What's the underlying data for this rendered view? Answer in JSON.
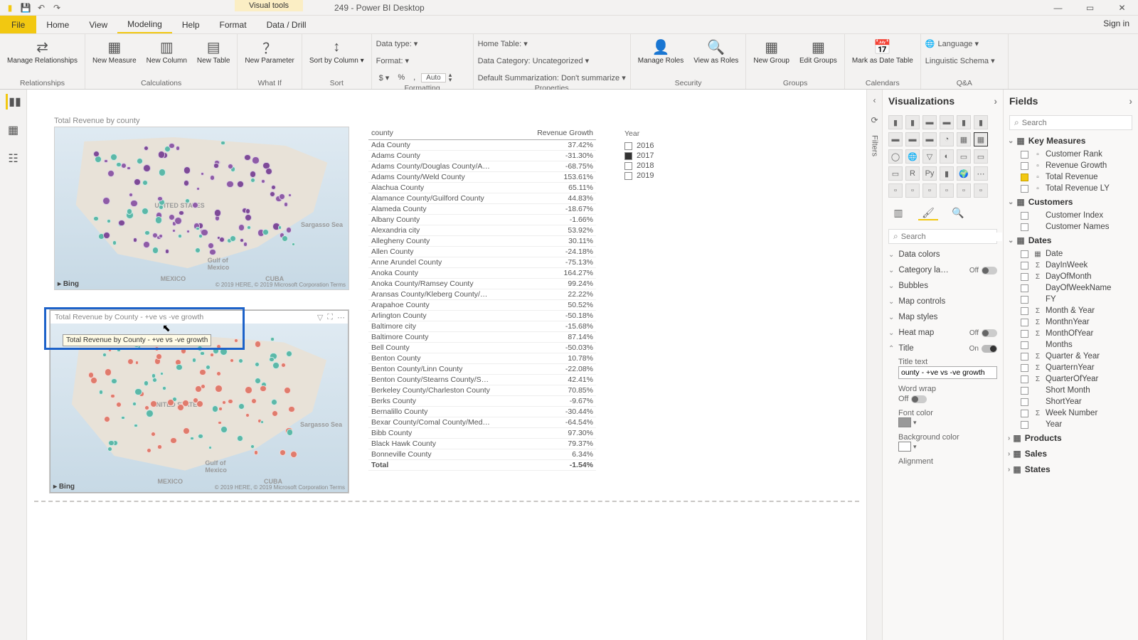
{
  "title": "249 - Power BI Desktop",
  "visualtools": "Visual tools",
  "menutabs": {
    "file": "File",
    "home": "Home",
    "view": "View",
    "modeling": "Modeling",
    "help": "Help",
    "format": "Format",
    "datadrill": "Data / Drill"
  },
  "signin": "Sign in",
  "ribbon": {
    "relationships": {
      "manage": "Manage\nRelationships",
      "group": "Relationships"
    },
    "calc": {
      "newmeasure": "New\nMeasure",
      "newcol": "New\nColumn",
      "newtable": "New\nTable",
      "group": "Calculations"
    },
    "whatif": {
      "newparam": "New\nParameter",
      "group": "What If"
    },
    "sort": {
      "sortby": "Sort by\nColumn ▾",
      "group": "Sort"
    },
    "formatting": {
      "datatype": "Data type:  ▾",
      "format": "Format:  ▾",
      "auto": "Auto",
      "group": "Formatting"
    },
    "props": {
      "home": "Home Table:  ▾",
      "cat": "Data Category: Uncategorized ▾",
      "summ": "Default Summarization: Don't summarize ▾",
      "group": "Properties"
    },
    "security": {
      "manage": "Manage\nRoles",
      "viewas": "View as\nRoles",
      "group": "Security"
    },
    "groups": {
      "new": "New\nGroup",
      "edit": "Edit\nGroups",
      "group": "Groups"
    },
    "calendars": {
      "mark": "Mark as\nDate Table",
      "group": "Calendars"
    },
    "qa": {
      "lang": "Language ▾",
      "schema": "Linguistic Schema ▾",
      "group": "Q&A"
    }
  },
  "map1title": "Total Revenue by county",
  "map2title": "Total Revenue by County - +ve vs -ve growth",
  "map2tt": "Total Revenue by County - +ve vs -ve growth",
  "bing": "Bing",
  "mapattr": "© 2019 HERE, © 2019 Microsoft Corporation  Terms",
  "maplbl": {
    "us": "UNITED STATES",
    "mexico": "MEXICO",
    "cuba": "CUBA",
    "gulf": "Gulf of\nMexico",
    "sea": "Sargasso Sea"
  },
  "table": {
    "headers": [
      "county",
      "Revenue Growth"
    ],
    "rows": [
      [
        "Ada County",
        "37.42%"
      ],
      [
        "Adams County",
        "-31.30%"
      ],
      [
        "Adams County/Douglas County/A…",
        "-68.75%"
      ],
      [
        "Adams County/Weld County",
        "153.61%"
      ],
      [
        "Alachua County",
        "65.11%"
      ],
      [
        "Alamance County/Guilford County",
        "44.83%"
      ],
      [
        "Alameda County",
        "-18.67%"
      ],
      [
        "Albany County",
        "-1.66%"
      ],
      [
        "Alexandria city",
        "53.92%"
      ],
      [
        "Allegheny County",
        "30.11%"
      ],
      [
        "Allen County",
        "-24.18%"
      ],
      [
        "Anne Arundel County",
        "-75.13%"
      ],
      [
        "Anoka County",
        "164.27%"
      ],
      [
        "Anoka County/Ramsey County",
        "99.24%"
      ],
      [
        "Aransas County/Kleberg County/…",
        "22.22%"
      ],
      [
        "Arapahoe County",
        "50.52%"
      ],
      [
        "Arlington County",
        "-50.18%"
      ],
      [
        "Baltimore city",
        "-15.68%"
      ],
      [
        "Baltimore County",
        "87.14%"
      ],
      [
        "Bell County",
        "-50.03%"
      ],
      [
        "Benton County",
        "10.78%"
      ],
      [
        "Benton County/Linn County",
        "-22.08%"
      ],
      [
        "Benton County/Stearns County/S…",
        "42.41%"
      ],
      [
        "Berkeley County/Charleston County",
        "70.85%"
      ],
      [
        "Berks County",
        "-9.67%"
      ],
      [
        "Bernalillo County",
        "-30.44%"
      ],
      [
        "Bexar County/Comal County/Med…",
        "-64.54%"
      ],
      [
        "Bibb County",
        "97.30%"
      ],
      [
        "Black Hawk County",
        "79.37%"
      ],
      [
        "Bonneville County",
        "6.34%"
      ]
    ],
    "total": [
      "Total",
      "-1.54%"
    ]
  },
  "slicer": {
    "title": "Year",
    "opts": [
      "2016",
      "2017",
      "2018",
      "2019"
    ],
    "sel": "2017"
  },
  "vizpane": {
    "title": "Visualizations",
    "search": "Search",
    "fmt": {
      "datacolors": "Data colors",
      "category": "Category la…",
      "bubbles": "Bubbles",
      "mapcontrols": "Map controls",
      "mapstyles": "Map styles",
      "heatmap": "Heat map",
      "title": "Title",
      "titletext": "Title text",
      "titleval": "ounty - +ve vs -ve growth",
      "wordwrap": "Word wrap",
      "fontcolor": "Font color",
      "bgcolor": "Background color",
      "alignment": "Alignment",
      "off": "Off",
      "on": "On"
    }
  },
  "fields": {
    "title": "Fields",
    "search": "Search",
    "tables": {
      "keymeasures": {
        "name": "Key Measures",
        "fields": [
          "Customer Rank",
          "Revenue Growth",
          "Total Revenue",
          "Total Revenue LY"
        ],
        "checked": [
          "Total Revenue"
        ]
      },
      "customers": {
        "name": "Customers",
        "fields": [
          "Customer Index",
          "Customer Names"
        ]
      },
      "dates": {
        "name": "Dates",
        "fields": [
          "Date",
          "DayInWeek",
          "DayOfMonth",
          "DayOfWeekName",
          "FY",
          "Month & Year",
          "MonthnYear",
          "MonthOfYear",
          "Months",
          "Quarter & Year",
          "QuarternYear",
          "QuarterOfYear",
          "Short Month",
          "ShortYear",
          "Week Number",
          "Year"
        ]
      },
      "products": {
        "name": "Products"
      },
      "sales": {
        "name": "Sales"
      },
      "states": {
        "name": "States"
      }
    }
  },
  "filters": "Filters"
}
